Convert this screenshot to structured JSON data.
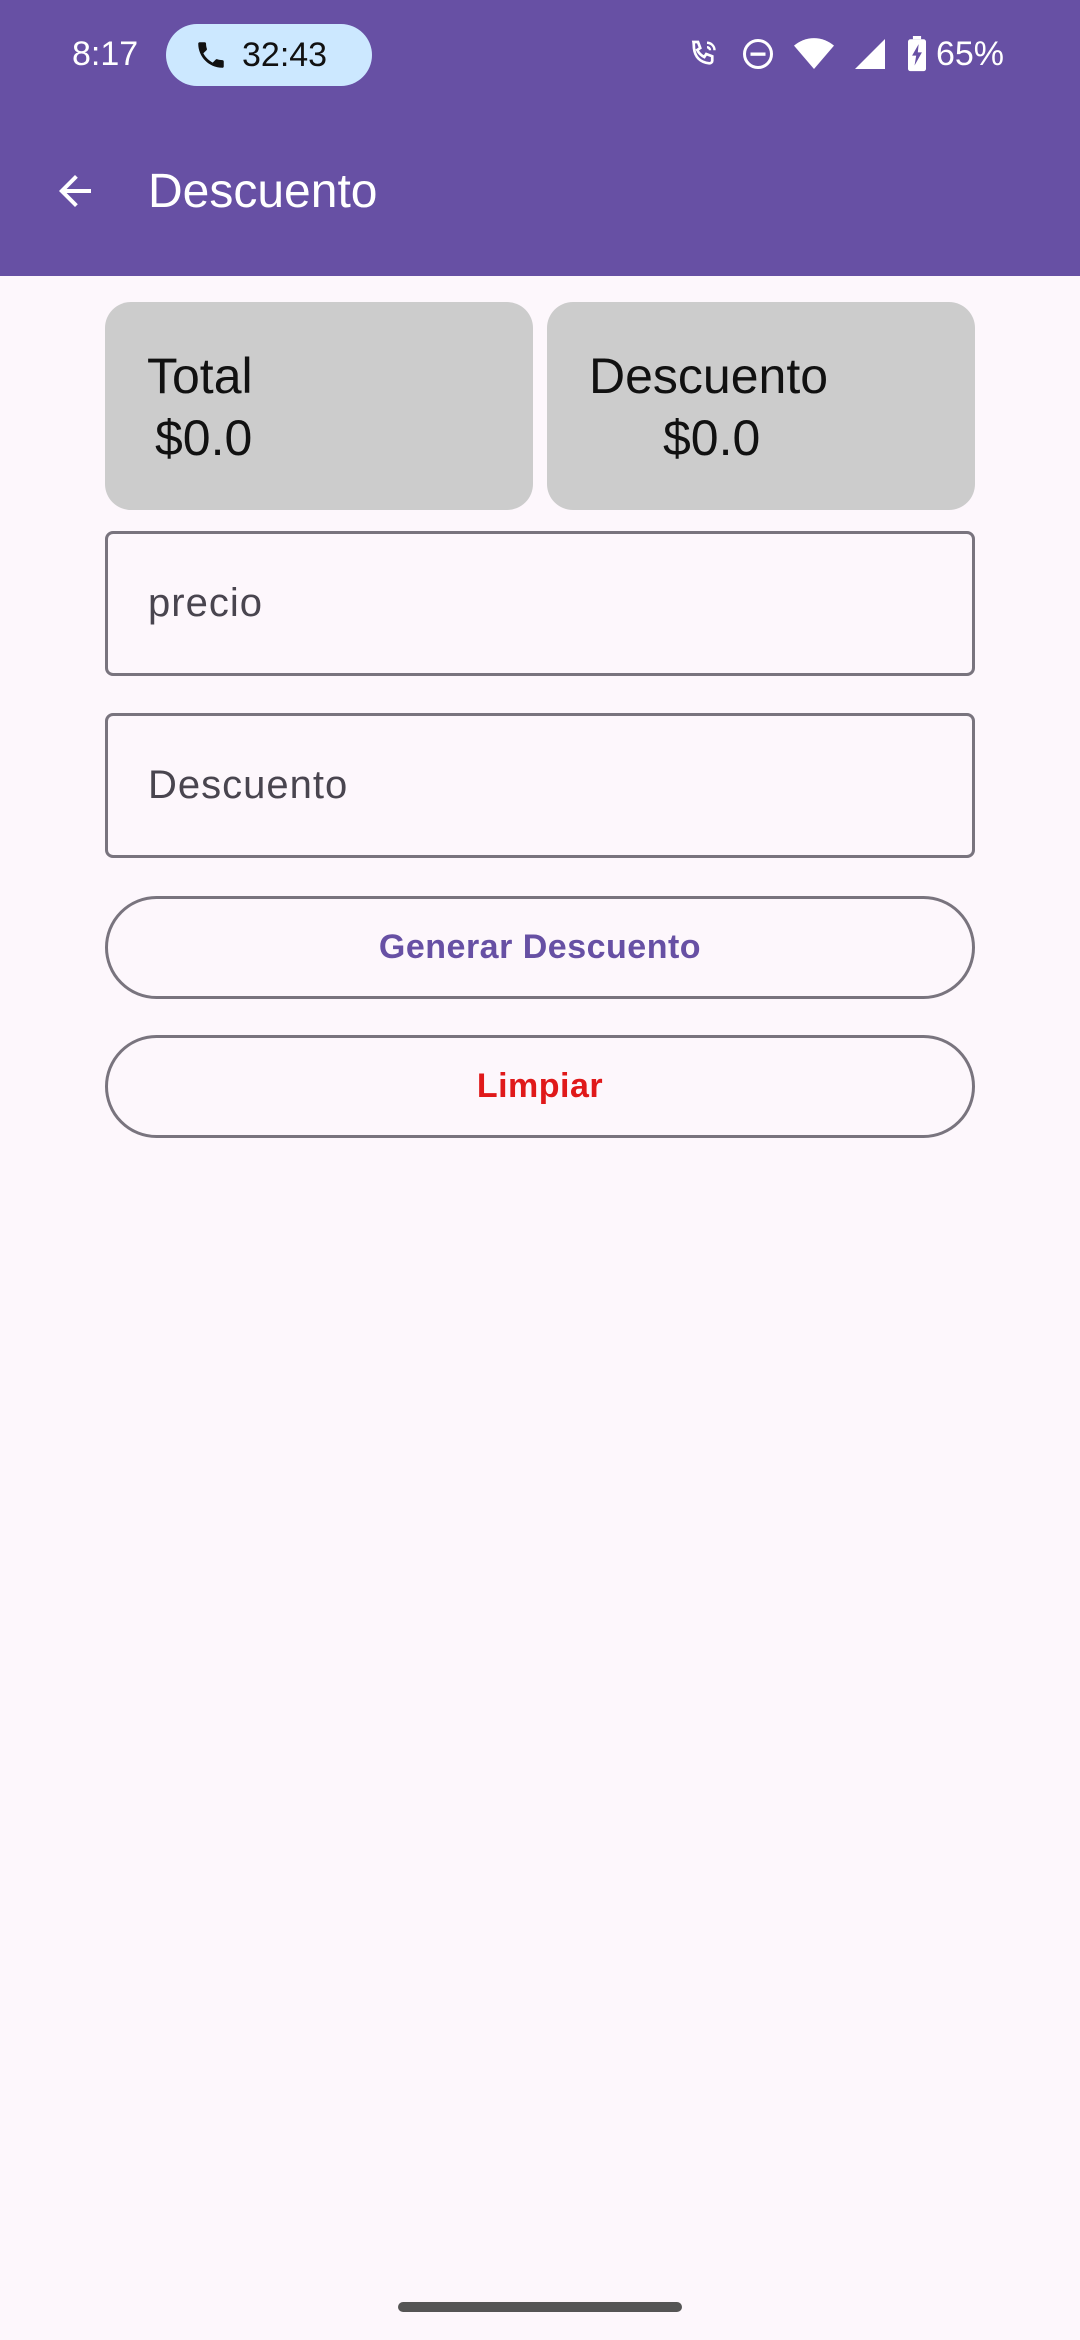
{
  "status_bar": {
    "time": "8:17",
    "call_timer": "32:43",
    "battery_percent": "65%",
    "icons": [
      "phone-icon",
      "wifi-calling-icon",
      "do-not-disturb-icon",
      "wifi-icon",
      "signal-icon",
      "battery-charging-icon"
    ]
  },
  "app_bar": {
    "title": "Descuento",
    "back_icon": "arrow-back-icon"
  },
  "cards": {
    "total": {
      "label": "Total",
      "value": "$0.0"
    },
    "descuento": {
      "label": "Descuento",
      "value": "$0.0"
    }
  },
  "form": {
    "precio_placeholder": "precio",
    "descuento_placeholder": "Descuento"
  },
  "buttons": {
    "generar_label": "Generar Descuento",
    "limpiar_label": "Limpiar"
  },
  "colors": {
    "primary": "#6750a4",
    "background": "#fdf7fc",
    "card": "#cccccc",
    "danger": "#e0191a",
    "call_pill": "#cce8ff"
  }
}
